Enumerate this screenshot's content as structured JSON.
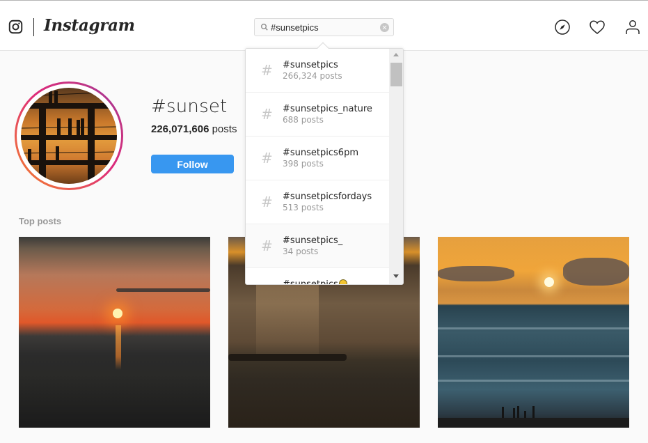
{
  "header": {
    "logo_icon": "instagram-glyph-icon",
    "wordmark": "Instagram",
    "search": {
      "value": "#sunsetpics",
      "icon": "search-icon",
      "clear_icon": "clear-icon"
    },
    "nav_icons": [
      "compass-explore-icon",
      "heart-activity-icon",
      "person-profile-icon"
    ]
  },
  "hashtag": {
    "title": "#sunset",
    "post_count": "226,071,606",
    "post_count_suffix": "posts",
    "follow_label": "Follow"
  },
  "sections": {
    "top_posts_label": "Top posts"
  },
  "posts": [
    {
      "description": "Sunset over the sea with sun reflection"
    },
    {
      "description": "Sun rays over valley with winding road"
    },
    {
      "description": "Sunset over ocean waves with silhouettes on beach"
    }
  ],
  "search_suggestions": [
    {
      "name": "#sunsetpics",
      "count": "266,324 posts"
    },
    {
      "name": "#sunsetpics_nature",
      "count": "688 posts"
    },
    {
      "name": "#sunsetpics6pm",
      "count": "398 posts"
    },
    {
      "name": "#sunsetpicsfordays",
      "count": "513 posts"
    },
    {
      "name": "#sunsetpics_",
      "count": "34 posts"
    },
    {
      "name": "#sunsetpics",
      "count": "",
      "has_emoji": true
    }
  ],
  "colors": {
    "accent": "#3897f0",
    "text": "#262626",
    "muted": "#999999",
    "border": "#dbdbdb"
  }
}
